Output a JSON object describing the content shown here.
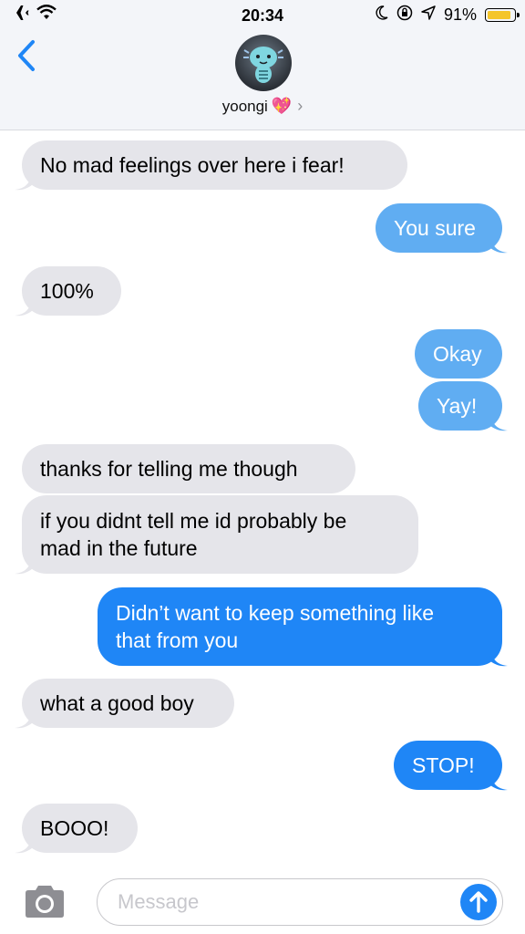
{
  "status_bar": {
    "time": "20:34",
    "battery_percent": "91%",
    "battery_level": 0.91
  },
  "contact": {
    "name": "yoongi",
    "emoji": "💖",
    "chevron": "›"
  },
  "messages": [
    {
      "text": "No mad feelings over here i fear!",
      "side": "received"
    },
    {
      "text": "You sure",
      "side": "sent"
    },
    {
      "text": "100%",
      "side": "received"
    },
    {
      "text": "Okay",
      "side": "sent"
    },
    {
      "text": "Yay!",
      "side": "sent"
    },
    {
      "text": "thanks for telling me though",
      "side": "received"
    },
    {
      "text": "if you didnt tell me id probably be\nmad in the future",
      "side": "received"
    },
    {
      "text": "Didn’t want to keep something like\nthat from you",
      "side": "sent"
    },
    {
      "text": "what a good boy",
      "side": "received"
    },
    {
      "text": "STOP!",
      "side": "sent"
    },
    {
      "text": "BOOO!",
      "side": "received"
    }
  ],
  "composer": {
    "placeholder": "Message"
  },
  "icons": {
    "airplane": "airplane-icon",
    "wifi": "wifi-icon",
    "moon": "moon-icon",
    "rotation_lock": "rotation-lock-icon",
    "location": "location-icon",
    "back": "chevron-left-icon",
    "camera": "camera-icon",
    "send": "send-arrow-icon"
  },
  "colors": {
    "sent_bubble": "#1f86f6",
    "sent_bubble_pending": "#60adf2",
    "received_bubble": "#e5e5ea",
    "accent": "#1f86f6"
  }
}
